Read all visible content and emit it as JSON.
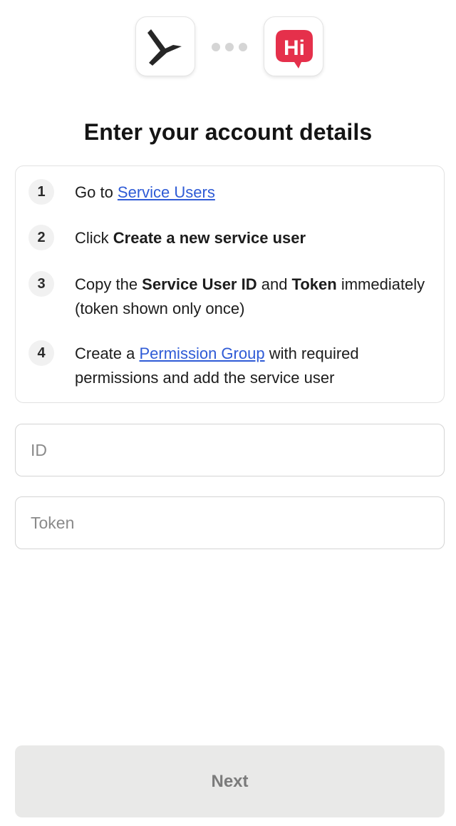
{
  "header": {
    "source_app_icon": "personio-logo-icon",
    "target_app_icon": "hi-chat-logo-icon",
    "target_app_logo_text": "Hi",
    "connector_icon": "ellipsis-dots-icon"
  },
  "title": "Enter your account details",
  "steps": [
    {
      "number": "1",
      "parts": [
        "Go to ",
        "Service Users"
      ]
    },
    {
      "number": "2",
      "parts": [
        "Click ",
        "Create a new service user"
      ]
    },
    {
      "number": "3",
      "parts": [
        "Copy the ",
        "Service User ID",
        " and ",
        "Token",
        " immediately (token shown only once)"
      ]
    },
    {
      "number": "4",
      "parts": [
        "Create a ",
        "Permission Group",
        " with required permissions and add the service user"
      ]
    }
  ],
  "fields": {
    "id": {
      "placeholder": "ID",
      "value": ""
    },
    "token": {
      "placeholder": "Token",
      "value": ""
    }
  },
  "actions": {
    "next_label": "Next"
  },
  "colors": {
    "link": "#2f5bd6",
    "brand_red": "#e5304b",
    "disabled_button_bg": "#e9e9e8",
    "disabled_button_text": "#7b7b7b"
  }
}
